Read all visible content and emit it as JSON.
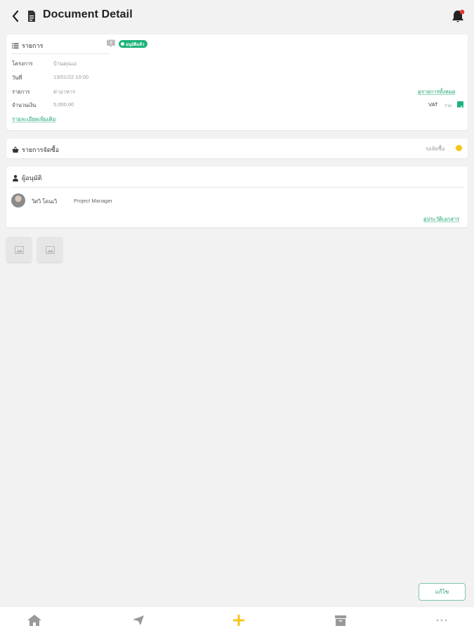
{
  "header": {
    "title": "Document Detail"
  },
  "details": {
    "section_label": "รายการ",
    "status": "อนุมัติแล้ว",
    "rows": [
      {
        "label": "โครงการ",
        "value": "บ้านคุณเอ"
      },
      {
        "label": "วันที่",
        "value": "13/01/22  10:00"
      },
      {
        "label": "รายการ",
        "value": "ค่าอาหาร"
      },
      {
        "label": "จำนวนเงิน",
        "value": "5,000.00"
      }
    ],
    "view_attachment_link": "ดูรายการทั้งหมด",
    "vat_label": "VAT",
    "vat_sub": "รวม",
    "vat_checked": true,
    "more_link": "รายละเอียดเพิ่มเติม"
  },
  "purchase": {
    "section_label": "รายการจัดซื้อ",
    "status_text": "รอจัดซื้อ",
    "status_color": "#f5c518"
  },
  "approver": {
    "section_label": "ผู้อนุมัติ",
    "name": "วิศวิ โคนเวิ",
    "role": "Project Manager",
    "history_link": "ดูประวัติเอกสาร"
  },
  "attachments": [
    {
      "icon": "image-icon"
    },
    {
      "icon": "image-icon"
    }
  ],
  "actions": {
    "edit_label": "แก้ไข"
  },
  "colors": {
    "accent": "#1aa36a",
    "badge": "#1fb37a",
    "nav_active": "#f5c518",
    "notification": "#e53935"
  },
  "nav": [
    {
      "icon": "home-icon"
    },
    {
      "icon": "send-icon"
    },
    {
      "icon": "plus-icon"
    },
    {
      "icon": "archive-icon"
    },
    {
      "icon": "more-icon"
    }
  ]
}
